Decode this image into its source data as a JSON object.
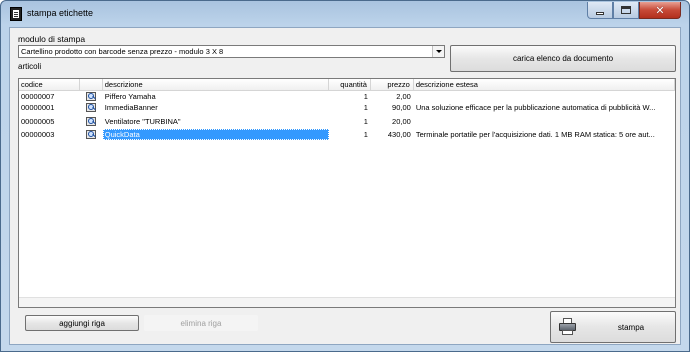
{
  "window": {
    "title": "stampa etichette",
    "icon": "document-window-icon"
  },
  "module": {
    "label": "modulo di stampa",
    "selected": "Cartellino prodotto con barcode senza prezzo - modulo 3 X 8",
    "load_button": "carica elenco da documento"
  },
  "articles": {
    "label": "articoli",
    "columns": {
      "code": "codice",
      "description": "descrizione",
      "quantity": "quantità",
      "price": "prezzo",
      "extended": "descrizione estesa"
    },
    "rows": [
      {
        "code": "00000007",
        "description": "Piffero Yamaha",
        "quantity": "1",
        "price": "2,00",
        "extended": ""
      },
      {
        "code": "00000001",
        "description": "ImmediaBanner",
        "quantity": "1",
        "price": "90,00",
        "extended": "Una soluzione efficace per la pubblicazione automatica di pubblicità W..."
      },
      {
        "code": "00000005",
        "description": "Ventilatore \"TURBINA\"",
        "quantity": "1",
        "price": "20,00",
        "extended": ""
      },
      {
        "code": "00000003",
        "description": "QuickData",
        "quantity": "1",
        "price": "430,00",
        "extended": "Terminale portatile per l'acquisizione dati. 1 MB RAM statica: 5 ore aut..."
      }
    ],
    "selected_row": 3
  },
  "actions": {
    "add_row": "aggiungi riga",
    "delete_row": "elimina riga",
    "print": "stampa"
  },
  "colors": {
    "selection": "#3399ff",
    "close_button": "#c74a38"
  }
}
